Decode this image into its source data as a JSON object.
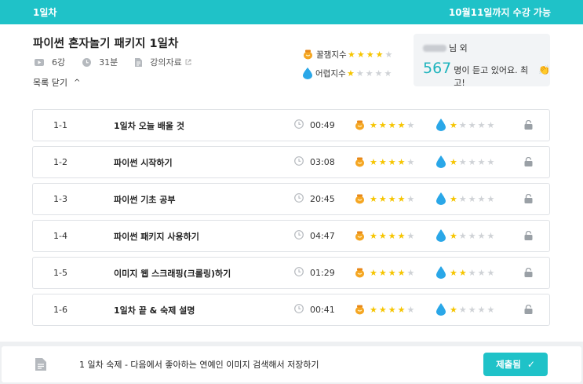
{
  "header": {
    "day_label": "1일차",
    "available_until": "10월11일까지 수강 가능"
  },
  "package": {
    "title": "파이썬 혼자놀기 패키지 1일차",
    "lecture_count": "6강",
    "duration": "31분",
    "materials_label": "강의자료"
  },
  "toggle_label": "목록 닫기",
  "indexes": {
    "honey_label": "꿀잼지수",
    "honey_rating": 4,
    "difficulty_label": "어렵지수",
    "difficulty_rating": 1
  },
  "viewers": {
    "suffix": "님 외",
    "count": "567",
    "message": "명이 듣고 있어요. 최고!"
  },
  "lessons": [
    {
      "num": "1-1",
      "title": "1일차 오늘 배울 것",
      "duration": "00:49",
      "honey": 4,
      "difficulty": 1
    },
    {
      "num": "1-2",
      "title": "파이썬 시작하기",
      "duration": "03:08",
      "honey": 4,
      "difficulty": 1
    },
    {
      "num": "1-3",
      "title": "파이썬 기초 공부",
      "duration": "20:45",
      "honey": 4,
      "difficulty": 1
    },
    {
      "num": "1-4",
      "title": "파이썬 패키지 사용하기",
      "duration": "04:47",
      "honey": 4,
      "difficulty": 1
    },
    {
      "num": "1-5",
      "title": "이미지 웹 스크래핑(크롤링)하기",
      "duration": "01:29",
      "honey": 4,
      "difficulty": 2
    },
    {
      "num": "1-6",
      "title": "1일차 끝 & 숙제 설명",
      "duration": "00:41",
      "honey": 4,
      "difficulty": 1
    }
  ],
  "homework": {
    "text": "1 일차 숙제 - 다음에서 좋아하는 연예인 이미지 검색해서 저장하기",
    "button_label": "제출됨"
  },
  "colors": {
    "accent": "#1fc2c8",
    "star_on": "#f6c500",
    "star_off": "#cfd2d6",
    "count": "#1fb4bd"
  }
}
